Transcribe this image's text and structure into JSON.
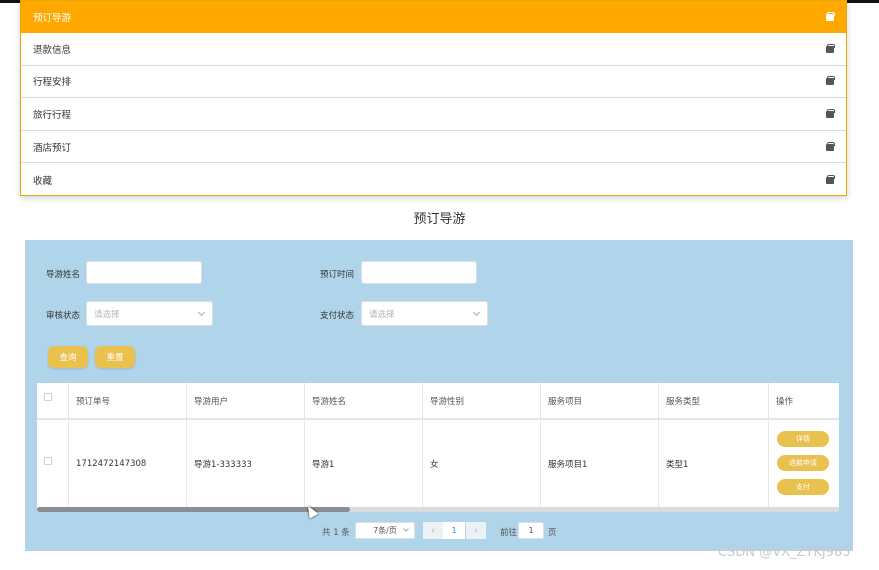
{
  "menu": {
    "items": [
      {
        "label": "预订导游",
        "icon": "bag-icon",
        "active": true
      },
      {
        "label": "退款信息",
        "icon": "bag-icon"
      },
      {
        "label": "行程安排",
        "icon": "bag-icon"
      },
      {
        "label": "旅行行程",
        "icon": "bag-icon"
      },
      {
        "label": "酒店预订",
        "icon": "bag-icon"
      },
      {
        "label": "收藏",
        "icon": "bag-icon"
      }
    ]
  },
  "page_title": "预订导游",
  "search": {
    "guide_name_label": "导游姓名",
    "guide_name_value": "",
    "booking_time_label": "预订时间",
    "booking_time_value": "",
    "review_status_label": "审核状态",
    "review_status_placeholder": "请选择",
    "pay_status_label": "支付状态",
    "pay_status_placeholder": "请选择",
    "query_button": "查询",
    "reset_button": "重置"
  },
  "table": {
    "headers": [
      "预订单号",
      "导游用户",
      "导游姓名",
      "导游性别",
      "服务项目",
      "服务类型",
      "操作"
    ],
    "rows": [
      {
        "order_no": "1712472147308",
        "guide_user": "导游1-333333",
        "guide_name": "导游1",
        "guide_gender": "女",
        "service_item": "服务项目1",
        "service_type": "类型1",
        "actions": [
          "详情",
          "退款申请",
          "支付"
        ]
      }
    ]
  },
  "pagination": {
    "total_text": "共 1 条",
    "page_size": "7条/页",
    "current_page": "1",
    "goto_label": "前往",
    "goto_value": "1",
    "page_suffix": "页"
  },
  "watermark": "CSDN @VX_ZYKJ985",
  "colors": {
    "accent": "#ffa900",
    "button": "#e8c14e",
    "panel_bg": "#b0d5ea"
  }
}
